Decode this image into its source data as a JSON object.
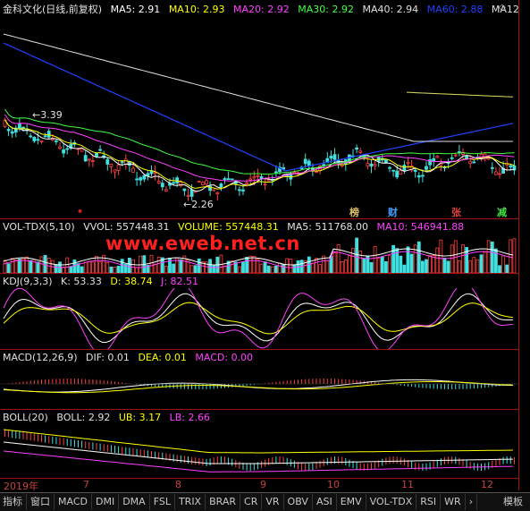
{
  "main_header": {
    "title": "金科文化(日线,前复权)",
    "ma5": "MA5: 2.91",
    "ma10": "MA10: 2.93",
    "ma20": "MA20: 2.92",
    "ma30": "MA30: 2.92",
    "ma40": "MA40: 2.94",
    "ma60": "MA60: 2.88",
    "ma12": "MA12",
    "ctrl": "◇"
  },
  "price_labels": {
    "high": "3.39",
    "low": "2.26"
  },
  "events": [
    {
      "label": "",
      "color": "#e02020"
    },
    {
      "label": "榜",
      "color": "#e0c060"
    },
    {
      "label": "财",
      "color": "#40a0ff"
    },
    {
      "label": "张",
      "color": "#e04040"
    },
    {
      "label": "减",
      "color": "#40e040"
    }
  ],
  "vol_header": {
    "title": "VOL-TDX(5,10)",
    "vvol": "VVOL: 557448.31",
    "volume": "VOLUME: 557448.31",
    "ma5": "MA5: 511768.00",
    "ma10": "MA10: 546941.88"
  },
  "watermark": "www.eweb.net.cn",
  "kdj_header": {
    "title": "KDJ(9,3,3)",
    "k": "K: 53.33",
    "d": "D: 38.74",
    "j": "J: 82.51"
  },
  "macd_header": {
    "title": "MACD(12,26,9)",
    "dif": "DIF: 0.01",
    "dea": "DEA: 0.01",
    "macd": "MACD: 0.00"
  },
  "boll_header": {
    "title": "BOLL(20)",
    "boll": "BOLL: 2.92",
    "ub": "UB: 3.17",
    "lb": "LB: 2.66"
  },
  "x_axis": [
    "2019年",
    "7",
    "8",
    "9",
    "10",
    "11",
    "12"
  ],
  "tabs": [
    "指标",
    "窗口",
    "MACD",
    "DMI",
    "DMA",
    "FSL",
    "TRIX",
    "BRAR",
    "CR",
    "VR",
    "OBV",
    "ASI",
    "EMV",
    "VOL-TDX",
    "RSI",
    "WR",
    "›"
  ],
  "tab_right": "模板",
  "colors": {
    "up": "#ff4040",
    "down": "#40e0e0",
    "ma5": "#ffffff",
    "ma10": "#ffff00",
    "ma20": "#ff40ff",
    "ma30": "#40ff40",
    "ma60": "#2040ff",
    "border": "#a01010"
  }
}
